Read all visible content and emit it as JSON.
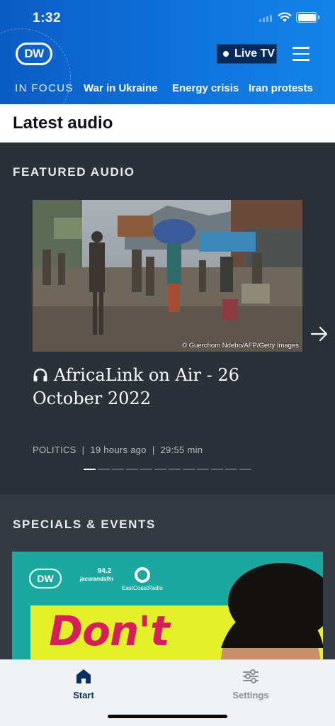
{
  "status_bar": {
    "time": "1:32"
  },
  "header": {
    "logo_text": "DW",
    "live_tv_label": "Live TV",
    "in_focus_label": "IN FOCUS",
    "focus_links": [
      "War in Ukraine",
      "Energy crisis",
      "Iran protests"
    ]
  },
  "page_title": "Latest audio",
  "featured": {
    "section_title": "FEATURED AUDIO",
    "image_credit": "© Guerchom Ndebo/AFP/Getty Images",
    "title": "AfricaLink on Air - 26 October 2022",
    "category": "POLITICS",
    "time_ago": "19 hours ago",
    "duration": "29:55 min",
    "slide_count": 12,
    "active_slide": 1
  },
  "specials": {
    "section_title": "SPECIALS & EVENTS",
    "banner": {
      "logo_dw": "DW",
      "logo_jacaranda_freq": "94.2",
      "logo_jacaranda": "jacarandafm",
      "logo_eastcoast": "EastCoastRadio",
      "headline_visible": "Don't"
    }
  },
  "tabbar": {
    "tabs": [
      {
        "label": "Start",
        "icon": "home-icon",
        "active": true
      },
      {
        "label": "Settings",
        "icon": "sliders-icon",
        "active": false
      }
    ]
  },
  "colors": {
    "header_blue": "#0f72dc",
    "live_tv_bg": "#042a5e",
    "dark_bg": "#2b3138",
    "specials_bg": "#333a42",
    "active_tab": "#0b2f63",
    "inactive_tab": "#8a8f96",
    "banner_teal": "#1ba8a0",
    "banner_yellow": "#e4f12a",
    "banner_pink": "#d81d5c"
  }
}
